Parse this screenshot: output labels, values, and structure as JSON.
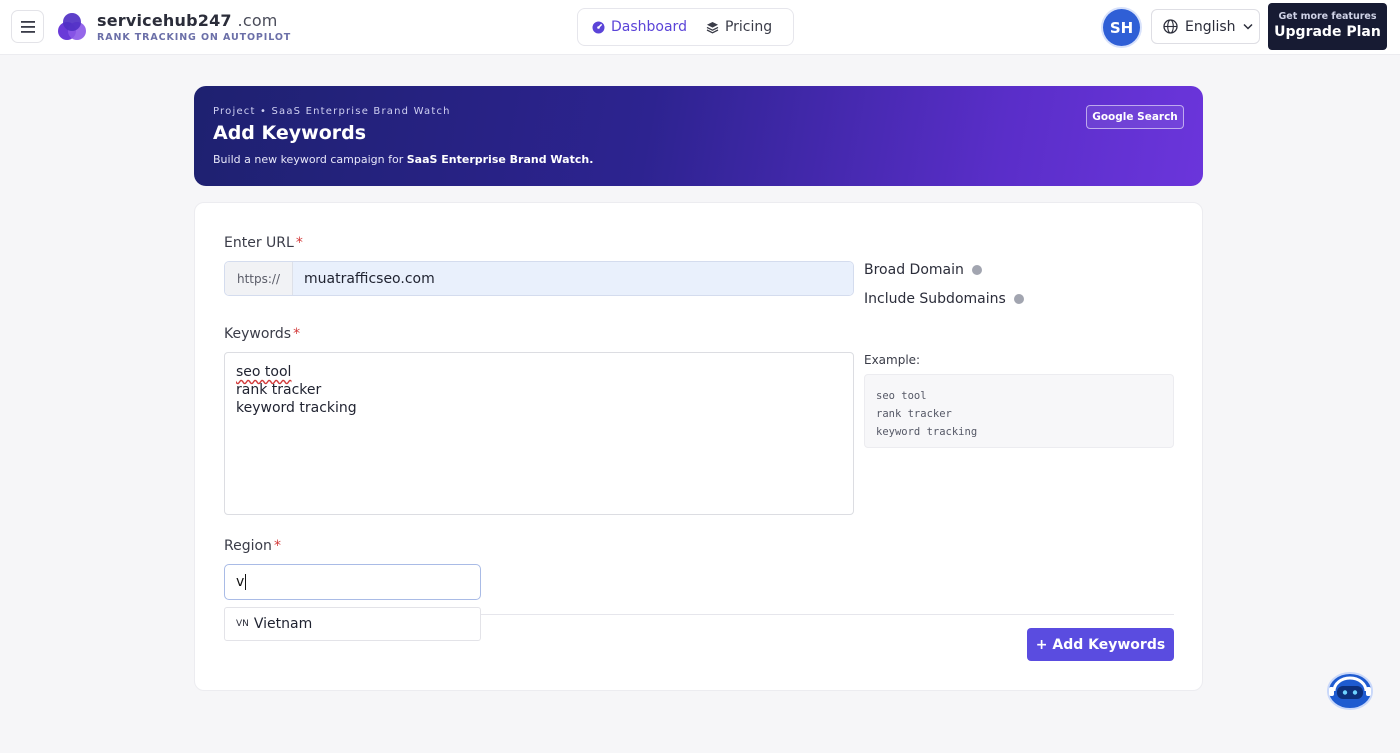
{
  "header": {
    "brand_name": "servicehub247",
    "brand_tld": ".com",
    "brand_tagline": "RANK TRACKING ON AUTOPILOT",
    "nav": [
      {
        "label": "Dashboard",
        "icon": "dashboard-icon",
        "active": true
      },
      {
        "label": "Pricing",
        "icon": "layers-icon",
        "active": false
      }
    ],
    "avatar_initials": "SH",
    "language": "English",
    "upgrade_small": "Get more features",
    "upgrade_label": "Upgrade Plan"
  },
  "hero": {
    "breadcrumb": "Project • SaaS Enterprise Brand Watch",
    "title": "Add Keywords",
    "subtitle_prefix": "Build a new keyword campaign for ",
    "subtitle_project": "SaaS Enterprise Brand Watch.",
    "engine_button": "Google Search"
  },
  "form": {
    "url_label": "Enter URL",
    "url_prefix": "https://",
    "url_value": "muatrafficseo.com",
    "broad_domain_label": "Broad Domain",
    "include_subdomains_label": "Include Subdomains",
    "keywords_label": "Keywords",
    "keywords": [
      "seo tool",
      "rank tracker",
      "keyword tracking"
    ],
    "example_title": "Example:",
    "example_lines": [
      "seo tool",
      "rank tracker",
      "keyword tracking"
    ],
    "region_label": "Region",
    "region_value": "v",
    "region_suggestion": {
      "code": "VN",
      "name": "Vietnam"
    },
    "submit_label": "+ Add Keywords",
    "required_mark": "*"
  },
  "colors": {
    "accent": "#5a4ce0",
    "dashboard_active": "#5b44d8",
    "upgrade_bg": "#171b33",
    "avatar_bg": "#2f5fd6",
    "required": "#d23a3a"
  }
}
